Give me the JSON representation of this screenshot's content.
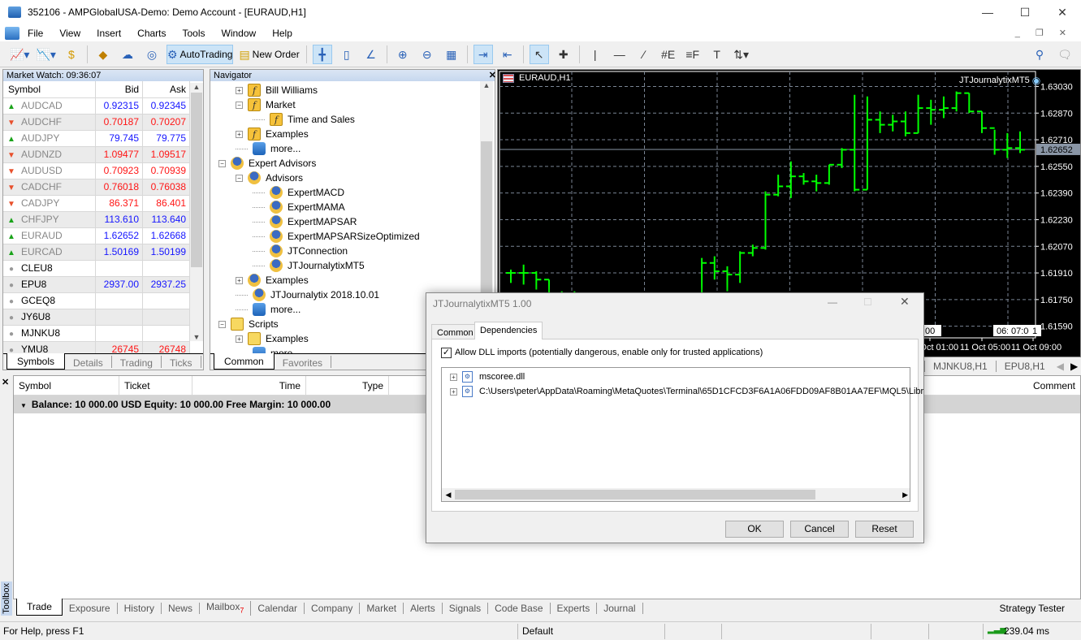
{
  "window": {
    "title": "352106 - AMPGlobalUSA-Demo: Demo Account - [EURAUD,H1]"
  },
  "menu": [
    "File",
    "View",
    "Insert",
    "Charts",
    "Tools",
    "Window",
    "Help"
  ],
  "toolbar": {
    "autotrading": "AutoTrading",
    "new_order": "New Order"
  },
  "market_watch": {
    "title": "Market Watch: 09:36:07",
    "columns": [
      "Symbol",
      "Bid",
      "Ask"
    ],
    "rows": [
      {
        "symbol": "AUDCAD",
        "dir": "up",
        "bid": "0.92315",
        "ask": "0.92345",
        "color": "blue"
      },
      {
        "symbol": "AUDCHF",
        "dir": "dn",
        "bid": "0.70187",
        "ask": "0.70207",
        "color": "red"
      },
      {
        "symbol": "AUDJPY",
        "dir": "up",
        "bid": "79.745",
        "ask": "79.775",
        "color": "blue"
      },
      {
        "symbol": "AUDNZD",
        "dir": "dn",
        "bid": "1.09477",
        "ask": "1.09517",
        "color": "red"
      },
      {
        "symbol": "AUDUSD",
        "dir": "dn",
        "bid": "0.70923",
        "ask": "0.70939",
        "color": "red"
      },
      {
        "symbol": "CADCHF",
        "dir": "dn",
        "bid": "0.76018",
        "ask": "0.76038",
        "color": "red"
      },
      {
        "symbol": "CADJPY",
        "dir": "dn",
        "bid": "86.371",
        "ask": "86.401",
        "color": "red"
      },
      {
        "symbol": "CHFJPY",
        "dir": "up",
        "bid": "113.610",
        "ask": "113.640",
        "color": "blue"
      },
      {
        "symbol": "EURAUD",
        "dir": "up",
        "bid": "1.62652",
        "ask": "1.62668",
        "color": "blue"
      },
      {
        "symbol": "EURCAD",
        "dir": "up",
        "bid": "1.50169",
        "ask": "1.50199",
        "color": "blue"
      },
      {
        "symbol": "CLEU8",
        "dir": "dot",
        "bid": "",
        "ask": "",
        "color": "blue"
      },
      {
        "symbol": "EPU8",
        "dir": "dot",
        "bid": "2937.00",
        "ask": "2937.25",
        "color": "blue"
      },
      {
        "symbol": "GCEQ8",
        "dir": "dot",
        "bid": "",
        "ask": "",
        "color": "blue"
      },
      {
        "symbol": "JY6U8",
        "dir": "dot",
        "bid": "",
        "ask": "",
        "color": "blue"
      },
      {
        "symbol": "MJNKU8",
        "dir": "dot",
        "bid": "",
        "ask": "",
        "color": "blue"
      },
      {
        "symbol": "YMU8",
        "dir": "dot",
        "bid": "26745",
        "ask": "26748",
        "color": "red"
      }
    ],
    "tabs": [
      "Symbols",
      "Details",
      "Trading",
      "Ticks"
    ]
  },
  "navigator": {
    "title": "Navigator",
    "items": [
      {
        "label": "Bill Williams",
        "level": 1,
        "icon": "indicator",
        "toggle": "+"
      },
      {
        "label": "Market",
        "level": 1,
        "icon": "indicator",
        "toggle": "-"
      },
      {
        "label": "Time and Sales",
        "level": 2,
        "icon": "indicator",
        "toggle": ""
      },
      {
        "label": "Examples",
        "level": 1,
        "icon": "indicator",
        "toggle": "+"
      },
      {
        "label": "more...",
        "level": 1,
        "icon": "more",
        "toggle": ""
      },
      {
        "label": "Expert Advisors",
        "level": 0,
        "icon": "expert",
        "toggle": "-"
      },
      {
        "label": "Advisors",
        "level": 1,
        "icon": "expert",
        "toggle": "-"
      },
      {
        "label": "ExpertMACD",
        "level": 2,
        "icon": "expert",
        "toggle": ""
      },
      {
        "label": "ExpertMAMA",
        "level": 2,
        "icon": "expert",
        "toggle": ""
      },
      {
        "label": "ExpertMAPSAR",
        "level": 2,
        "icon": "expert",
        "toggle": ""
      },
      {
        "label": "ExpertMAPSARSizeOptimized",
        "level": 2,
        "icon": "expert",
        "toggle": ""
      },
      {
        "label": "JTConnection",
        "level": 2,
        "icon": "expert",
        "toggle": ""
      },
      {
        "label": "JTJournalytixMT5",
        "level": 2,
        "icon": "expert",
        "toggle": ""
      },
      {
        "label": "Examples",
        "level": 1,
        "icon": "expert",
        "toggle": "+"
      },
      {
        "label": "JTJournalytix 2018.10.01",
        "level": 1,
        "icon": "expert",
        "toggle": ""
      },
      {
        "label": "more...",
        "level": 1,
        "icon": "more",
        "toggle": ""
      },
      {
        "label": "Scripts",
        "level": 0,
        "icon": "script",
        "toggle": "-"
      },
      {
        "label": "Examples",
        "level": 1,
        "icon": "script",
        "toggle": "+"
      },
      {
        "label": "more...",
        "level": 1,
        "icon": "more",
        "toggle": ""
      }
    ],
    "tabs": [
      "Common",
      "Favorites"
    ]
  },
  "chart_data": {
    "type": "ohlc",
    "title": "EURAUD,H1",
    "expert_label": "JTJournalytixMT5",
    "current_price": "1.62652",
    "yticks": [
      "1.63030",
      "1.62870",
      "1.62710",
      "1.62550",
      "1.62390",
      "1.62230",
      "1.62070",
      "1.61910",
      "1.61750",
      "1.61590"
    ],
    "ylim": [
      1.6152,
      1.6312
    ],
    "xticks": [
      "11 Oct 01:00",
      "11 Oct 05:00",
      "11 Oct 09:00"
    ],
    "time_flags": [
      ":00",
      "06:",
      "07:00",
      "1"
    ],
    "grid": true,
    "bar_color": "#00ff00",
    "ohlc": [
      [
        1.6191,
        1.6193,
        1.6185,
        1.6191
      ],
      [
        1.6191,
        1.6196,
        1.6184,
        1.6191
      ],
      [
        1.6191,
        1.6192,
        1.6181,
        1.6187
      ],
      [
        1.6187,
        1.6187,
        1.6176,
        1.6177
      ],
      [
        1.6177,
        1.618,
        1.617,
        1.6175
      ],
      [
        1.6175,
        1.618,
        1.6172,
        1.6176
      ],
      [
        1.6176,
        1.6179,
        1.617,
        1.6175
      ],
      [
        1.6175,
        1.6177,
        1.6168,
        1.6172
      ],
      [
        1.6172,
        1.6176,
        1.6168,
        1.6173
      ],
      [
        1.6173,
        1.6178,
        1.6169,
        1.6174
      ],
      [
        1.6174,
        1.6176,
        1.6168,
        1.6172
      ],
      [
        1.6172,
        1.6174,
        1.6166,
        1.617
      ],
      [
        1.617,
        1.6173,
        1.6165,
        1.6169
      ],
      [
        1.6169,
        1.6172,
        1.6166,
        1.617
      ],
      [
        1.617,
        1.6172,
        1.6166,
        1.617
      ],
      [
        1.617,
        1.62,
        1.6168,
        1.6197
      ],
      [
        1.6197,
        1.6201,
        1.6187,
        1.6192
      ],
      [
        1.6192,
        1.6195,
        1.618,
        1.619
      ],
      [
        1.619,
        1.6204,
        1.6185,
        1.6203
      ],
      [
        1.6203,
        1.6208,
        1.6201,
        1.6206
      ],
      [
        1.6206,
        1.624,
        1.6205,
        1.6238
      ],
      [
        1.6238,
        1.625,
        1.6237,
        1.6243
      ],
      [
        1.6243,
        1.6258,
        1.6236,
        1.6249
      ],
      [
        1.6249,
        1.6251,
        1.6244,
        1.6246
      ],
      [
        1.6246,
        1.625,
        1.624,
        1.6245
      ],
      [
        1.6245,
        1.6256,
        1.6244,
        1.6256
      ],
      [
        1.6256,
        1.6266,
        1.6254,
        1.6265
      ],
      [
        1.6265,
        1.6298,
        1.624,
        1.6241
      ],
      [
        1.6241,
        1.6297,
        1.6241,
        1.6283
      ],
      [
        1.6283,
        1.6288,
        1.6275,
        1.628
      ],
      [
        1.628,
        1.6286,
        1.6276,
        1.6282
      ],
      [
        1.6282,
        1.6288,
        1.6273,
        1.6275
      ],
      [
        1.6275,
        1.6298,
        1.6275,
        1.629
      ],
      [
        1.629,
        1.6295,
        1.628,
        1.6289
      ],
      [
        1.6289,
        1.6297,
        1.6284,
        1.629
      ],
      [
        1.629,
        1.63,
        1.6288,
        1.6299
      ],
      [
        1.6299,
        1.6299,
        1.6287,
        1.6288
      ],
      [
        1.6288,
        1.6288,
        1.6275,
        1.6278
      ],
      [
        1.6278,
        1.6277,
        1.6262,
        1.6265
      ],
      [
        1.6265,
        1.6275,
        1.626,
        1.6266
      ],
      [
        1.6266,
        1.6276,
        1.6263,
        1.6265
      ]
    ]
  },
  "chart_tabs": [
    "MJNKU8,H1",
    "EPU8,H1"
  ],
  "toolbox": {
    "side_label": "Toolbox",
    "columns": [
      "Symbol",
      "Ticket",
      "Time",
      "Type",
      "Comment"
    ],
    "balance": "Balance: 10 000.00 USD  Equity: 10 000.00  Free Margin: 10 000.00",
    "tabs": [
      "Trade",
      "Exposure",
      "History",
      "News",
      "Mailbox",
      "Calendar",
      "Company",
      "Market",
      "Alerts",
      "Signals",
      "Code Base",
      "Experts",
      "Journal"
    ],
    "mailbox_count": "7",
    "strategy_tester": "Strategy Tester"
  },
  "status": {
    "help": "For Help, press F1",
    "profile": "Default",
    "ping": "239.04 ms"
  },
  "dialog": {
    "title": "JTJournalytixMT5 1.00",
    "tabs": [
      "Common",
      "Dependencies"
    ],
    "allow_dll": "Allow DLL imports (potentially dangerous, enable only for trusted applications)",
    "allow_dll_checked": true,
    "dependencies": [
      "mscoree.dll",
      "C:\\Users\\peter\\AppData\\Roaming\\MetaQuotes\\Terminal\\65D1CFCD3F6A1A06FDD09AF8B01AA7EF\\MQL5\\Libr"
    ],
    "buttons": {
      "ok": "OK",
      "cancel": "Cancel",
      "reset": "Reset"
    }
  }
}
